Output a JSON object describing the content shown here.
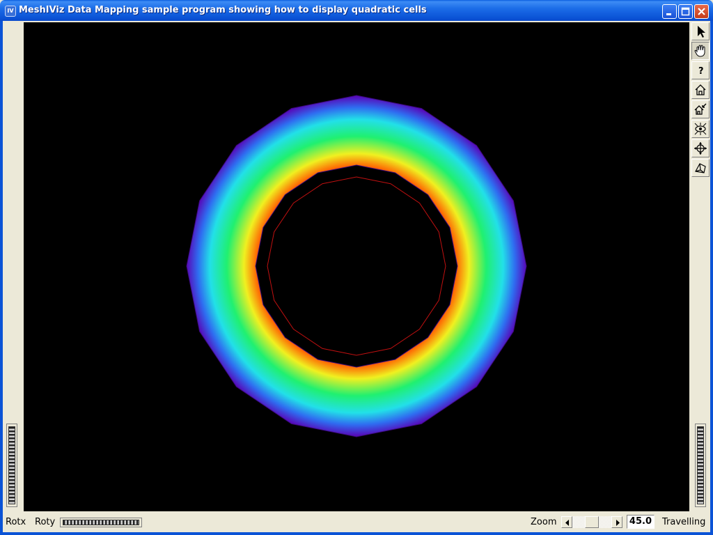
{
  "window": {
    "title": "MeshIViz Data Mapping sample program showing how to display quadratic cells",
    "icon": "app-icon",
    "controls": [
      "minimize-icon",
      "maximize-icon",
      "close-icon"
    ]
  },
  "viewer": {
    "background": "#000000",
    "ring_colors": [
      "#5a00b4",
      "#2f6cf0",
      "#22e0e8",
      "#20f070",
      "#f0f020",
      "#ff5a00",
      "#e00000",
      "#251410"
    ]
  },
  "toolbar": {
    "tools": [
      {
        "name": "select-arrow-icon",
        "pressed": false
      },
      {
        "name": "view-hand-icon",
        "pressed": true
      },
      {
        "name": "help-icon",
        "label": "?",
        "pressed": false
      },
      {
        "name": "home-icon",
        "pressed": false
      },
      {
        "name": "set-home-icon",
        "pressed": false
      },
      {
        "name": "view-all-icon",
        "pressed": false
      },
      {
        "name": "seek-icon",
        "pressed": false
      },
      {
        "name": "perspective-icon",
        "pressed": false
      }
    ]
  },
  "bottom": {
    "rotx_label": "Rotx",
    "roty_label": "Roty",
    "zoom_label": "Zoom",
    "zoom_value": "45.0",
    "travelling_label": "Travelling"
  }
}
